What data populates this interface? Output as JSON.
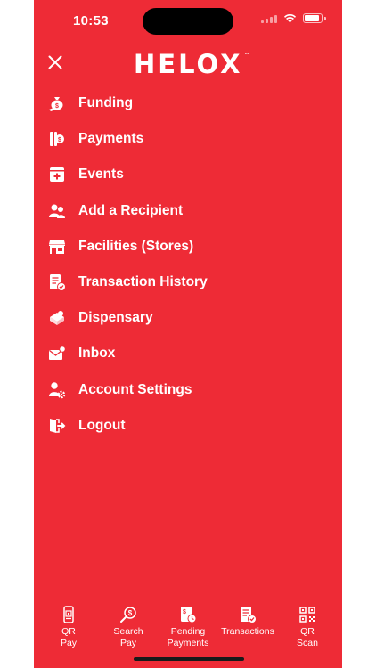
{
  "status_bar": {
    "time": "10:53"
  },
  "header": {
    "logo_text": "HELOX",
    "logo_mark": "™"
  },
  "menu": {
    "items": [
      {
        "label": "Funding",
        "icon": "money-bag-icon"
      },
      {
        "label": "Payments",
        "icon": "payment-icon"
      },
      {
        "label": "Events",
        "icon": "event-icon"
      },
      {
        "label": "Add a Recipient",
        "icon": "users-icon"
      },
      {
        "label": "Facilities (Stores)",
        "icon": "store-icon"
      },
      {
        "label": "Transaction History",
        "icon": "receipt-icon"
      },
      {
        "label": "Dispensary",
        "icon": "dispensary-icon"
      },
      {
        "label": "Inbox",
        "icon": "inbox-icon"
      },
      {
        "label": "Account Settings",
        "icon": "user-settings-icon"
      },
      {
        "label": "Logout",
        "icon": "logout-icon"
      }
    ]
  },
  "bottom_nav": {
    "tabs": [
      {
        "label": "QR\nPay",
        "icon": "qr-pay-icon"
      },
      {
        "label": "Search\nPay",
        "icon": "search-pay-icon"
      },
      {
        "label": "Pending\nPayments",
        "icon": "pending-payments-icon"
      },
      {
        "label": "Transactions",
        "icon": "transactions-icon"
      },
      {
        "label": "QR\nScan",
        "icon": "qr-scan-icon"
      }
    ]
  },
  "colors": {
    "background": "#EE2B36",
    "text": "#FFFFFF"
  }
}
